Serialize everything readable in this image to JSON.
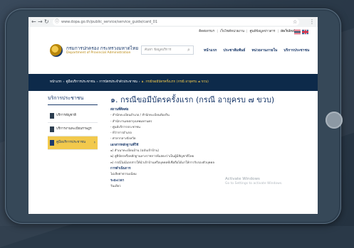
{
  "browser": {
    "url": "www.dopa.go.th/public_service/service_guide/card_01",
    "icons": {
      "back": "arrow-left-icon",
      "forward": "arrow-right-icon",
      "reload": "reload-icon",
      "lock": "lock-icon",
      "star": "star-icon",
      "menu": "kebab-icon"
    }
  },
  "utility": {
    "links": [
      "ติดต่อกรมฯ",
      "เว็บไซต์หน่วยงาน",
      "ศูนย์ข้อมูลข่าวสาร",
      "ผังเว็บไซต์"
    ],
    "font_control": "ก- ก+"
  },
  "header": {
    "dept_th": "กรมการปกครอง กระทรวงมหาดไทย",
    "dept_en": "Department of Provincial Administration",
    "search_placeholder": "ค้นหา ข้อมูลบริการ",
    "nav": [
      "หน้าแรก",
      "ประชาสัมพันธ์",
      "หน่วยงานภายใน",
      "บริการประชาชน"
    ]
  },
  "breadcrumb": [
    "หน้าแรก",
    "คู่มือบริการประชาชน",
    "การบัตรประจำตัวประชาชน",
    "๑. กรณีขอมีบัตรครั้งแรก (กรณี อายุครบ ๗ ขวบ)"
  ],
  "sidebar": {
    "title": "บริการประชาชน",
    "items": [
      {
        "label": "บริการสัญชาติ"
      },
      {
        "label": "บริการงานทะเบียนราษฎร"
      },
      {
        "label": "คู่มือบริการประชาชน"
      }
    ]
  },
  "content": {
    "title": "๑. กรณีขอมีบัตรครั้งแรก (กรณี อายุครบ ๗ ขวบ)",
    "section1": "สถานที่ติดต่อ",
    "lines1": [
      "- สำนักทะเบียนอำเภอ / สำนักทะเบียนท้องถิ่น",
      "- สำนักงานเขตกรุงเทพมหานคร",
      "- ศูนย์บริการประชาชน",
      "- ที่ว่าการอำเภอ",
      "- ศาลากลางจังหวัด"
    ],
    "section2": "เอกสารหลักฐานที่ใช้",
    "lines2": [
      "๑) สำเนาทะเบียนบ้าน (ฉบับเจ้าบ้าน)",
      "๒) สูติบัตรหรือหลักฐานทางราชการที่แสดงว่าเป็นผู้มีสัญชาติไทย",
      "๓) กรณีไม่มีเอกสารให้นำเจ้าบ้านหรือบุคคลที่เชื่อถือได้มาให้การรับรองตัวบุคคล"
    ],
    "section3": "การดำเนินการ",
    "line3": "ไม่เสียค่าธรรมเนียม",
    "section4": "ระยะเวลา",
    "line4": "วันเดียว"
  },
  "watermark": {
    "line1": "Activate Windows",
    "line2": "Go to Settings to activate Windows."
  }
}
